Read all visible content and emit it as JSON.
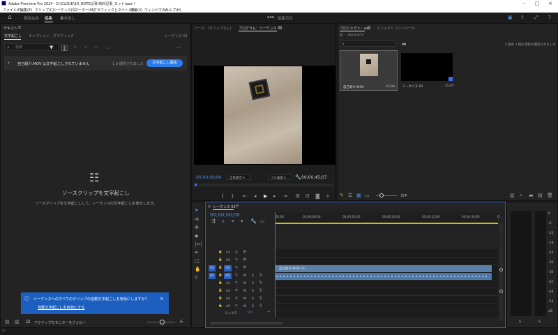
{
  "titlebar": {
    "title": "Adobe Premiere Pro 2024 - D:\\CLOUD\\10_NOTE記事\\有料記事_カット\\aaa *"
  },
  "menu": [
    "ファイル(F)",
    "編集(E)",
    "クリップ(C)",
    "シーケンス(S)",
    "マーカー(M)",
    "グラフィックとタイトル(G)",
    "表示(V)",
    "ウィンドウ(W)",
    "ヘルプ(H)"
  ],
  "workspaces": {
    "tabs": [
      "読み込み",
      "編集",
      "書き出し"
    ],
    "active": "編集",
    "center_title": "aaa",
    "center_sub": "編集済み"
  },
  "text_panel": {
    "title": "テキスト",
    "tabs": [
      "文字起こし",
      "キャプション",
      "グラフィック"
    ],
    "active_tab": "文字起こし",
    "sequence_label": "シーケンス 01",
    "search_placeholder": "検索",
    "clip_row": {
      "label": "自己紹介.MOV は文字起こしされていません",
      "selected": "1 が選択されました",
      "button": "文字起こし開始"
    },
    "empty_title": "ソースクリップを文字起こし",
    "empty_desc": "ソースクリップを文字起こしして、シーケンスの文字起こしを表示します。",
    "notice": {
      "text": "シーケンスへのすべてのクリップの自動文字起こしを有効にしますか？",
      "link": "自動文字起こしを有効にする"
    },
    "follow_monitor": "アクティブなモニターをフォロー"
  },
  "program_monitor": {
    "tabs": [
      "ソース：(クリップなし)",
      "プログラム：シーケンス 01"
    ],
    "active_tab": "プログラム：シーケンス 01",
    "timecode_left": "00;00;00;00",
    "fit": "全体表示",
    "quality": "フル画質",
    "timecode_right": "00;00;45;07"
  },
  "project_panel": {
    "tabs": [
      "プロジェクト：aaa",
      "エフェクトコントロール"
    ],
    "active_tab": "プロジェクト：aaa",
    "file": "aaa.prproj",
    "search_placeholder": "",
    "selection_info": "2 個中 1 個の項目が選択されました",
    "items": [
      {
        "name": "自己紹介.MOV",
        "duration": "45;08"
      },
      {
        "name": "シーケンス 01",
        "duration": "45;07"
      }
    ]
  },
  "timeline": {
    "sequence_tab": "シーケンス 01",
    "timecode": "00;00;00;00",
    "ruler": [
      "00;00",
      "00;00;08;00",
      "00;00;16;00",
      "00;00;24;00",
      "00;00;32;00",
      "00;00;40;00"
    ],
    "video_tracks": [
      "V3",
      "V2",
      "V1"
    ],
    "audio_tracks": [
      "A1",
      "A2",
      "A3",
      "A4",
      "A5"
    ],
    "source_v": "V1",
    "source_a": "A1",
    "mix_label": "ミックス",
    "mix_value": "0.0",
    "video_clip": "自己紹介.MOV [V]",
    "playhead_fraction": 0.0
  },
  "meter": {
    "scale": [
      "0",
      "-6",
      "-12",
      "-18",
      "-24",
      "-30",
      "-36",
      "-42",
      "-48",
      "-54",
      "dB"
    ],
    "channels": [
      "S",
      "S"
    ]
  },
  "colors": {
    "accent": "#2b7ce9",
    "clip": "#5a7fa8",
    "notice": "#1d5fbf",
    "playhead": "#3b6ef0"
  }
}
